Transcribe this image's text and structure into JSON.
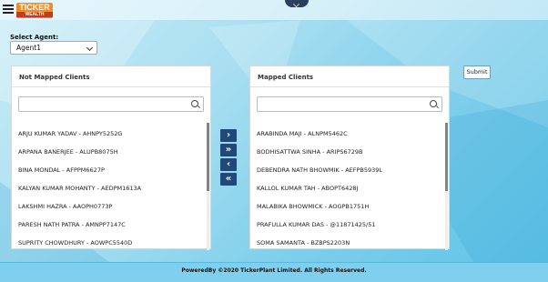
{
  "header": {
    "logo_text": "TICKER",
    "logo_sub": "WEALTH"
  },
  "agent": {
    "label": "Select Agent:",
    "selected": "Agent1"
  },
  "not_mapped": {
    "title": "Not Mapped Clients",
    "items": [
      "ARJU KUMAR YADAV - AHNPY5252G",
      "ARPANA BANERJEE - ALUPB8075H",
      "BINA MONDAL - AFPPM6627P",
      "KALYAN KUMAR MOHANTY - AEDPM1613A",
      "LAKSHMI HAZRA - AAOPH0773P",
      "PARESH NATH PATRA - AMNPP7147C",
      "SUPRITY CHOWDHURY - AOWPC5540D"
    ]
  },
  "mapped": {
    "title": "Mapped Clients",
    "items": [
      "ARABINDA MAJI - ALNPM5462C",
      "BODHISATTWA SINHA - ARIPS6729B",
      "DEBENDRA NATH BHOWMIK - AEFPB5939L",
      "KALLOL KUMAR TAH - ABOPT6428J",
      "MALABIKA BHOWMICK - AOGPB1751H",
      "PRAFULLA KUMAR DAS - @11871425/51",
      "SOMA SAMANTA - BZBPS2203N"
    ]
  },
  "buttons": {
    "move_right": "›",
    "move_all_right": "»",
    "move_left": "‹",
    "move_all_left": "«",
    "submit": "Submit"
  },
  "footer": {
    "text": "PoweredBy ©2020 TickerPlant Limited. All Rights Reserved."
  },
  "colors": {
    "button_blue": "#21487a",
    "footer_bg": "#7fd0ef",
    "logo_orange": "#f28c28"
  }
}
